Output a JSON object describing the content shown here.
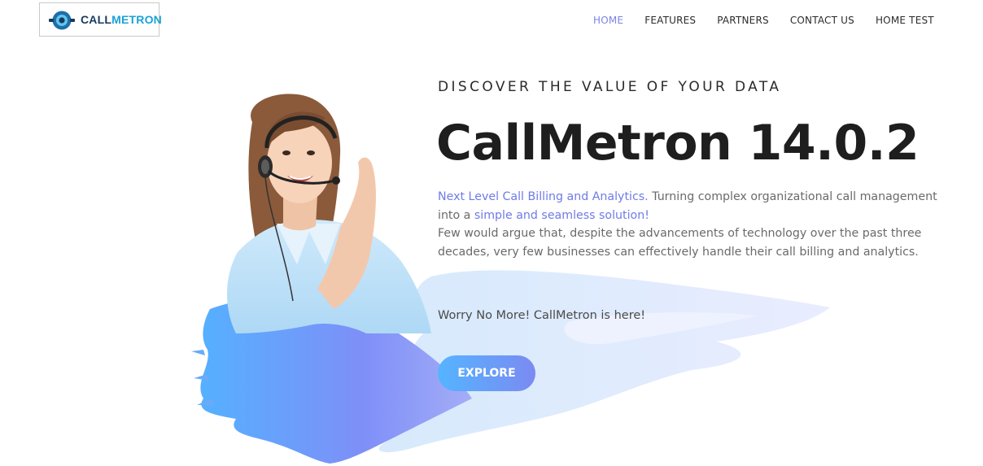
{
  "brand": {
    "name_part1": "CALL",
    "name_part2": "METRON"
  },
  "nav": {
    "items": [
      {
        "label": "HOME",
        "active": true
      },
      {
        "label": "FEATURES"
      },
      {
        "label": "PARTNERS"
      },
      {
        "label": "CONTACT US"
      },
      {
        "label": "HOME TEST"
      }
    ]
  },
  "hero": {
    "eyebrow": "DISCOVER THE VALUE OF YOUR DATA",
    "title": "CallMetron 14.0.2",
    "desc_highlight1": "Next Level Call Billing and Analytics.",
    "desc_text1": " Turning complex organizational call management into a ",
    "desc_highlight2": "simple and seamless solution!",
    "desc_text2": "Few would argue that, despite the advancements of technology over the past three decades, very few businesses can effectively handle their call billing and analytics.",
    "tagline": "Worry No More! CallMetron is here!",
    "cta_label": "EXPLORE"
  },
  "colors": {
    "accent": "#7b84e8",
    "highlight_text": "#6f7be6",
    "button_gradient_start": "#55b4ff",
    "button_gradient_end": "#7b8af2",
    "logo_dark": "#173a5e",
    "logo_light": "#1aa2d8"
  },
  "icons": {
    "logo": "callmetron-logo-icon",
    "hero": "headset-agent-illustration"
  }
}
